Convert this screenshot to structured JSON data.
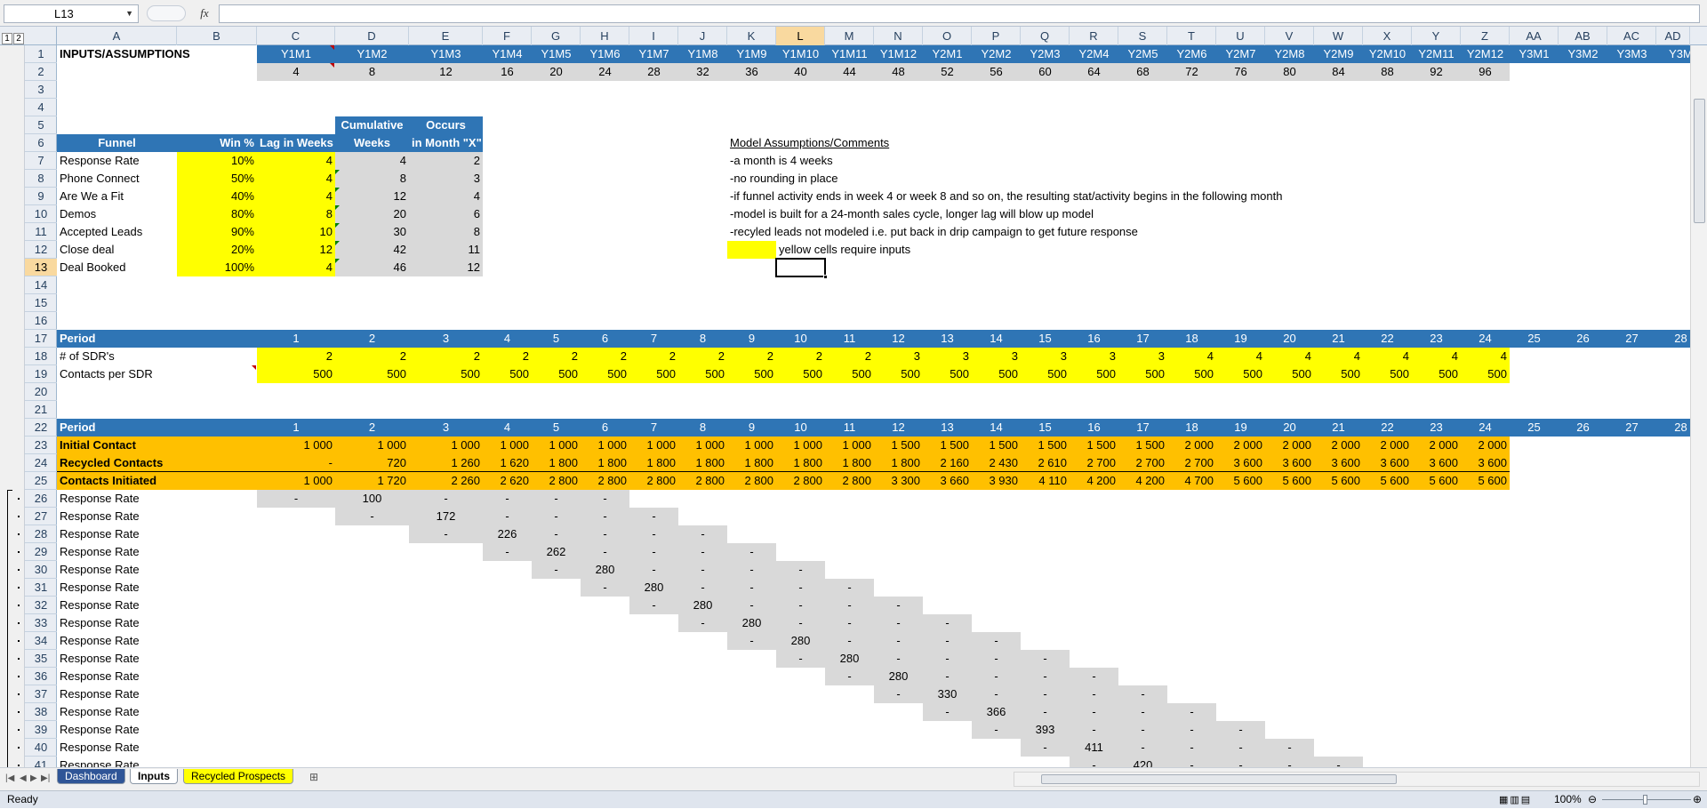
{
  "name_box": "L13",
  "formula_bar": {
    "fx": "fx",
    "value": ""
  },
  "outline_levels": [
    "1",
    "2"
  ],
  "columns": [
    "A",
    "B",
    "C",
    "D",
    "E",
    "F",
    "G",
    "H",
    "I",
    "J",
    "K",
    "L",
    "M",
    "N",
    "O",
    "P",
    "Q",
    "R",
    "S",
    "T",
    "U",
    "V",
    "W",
    "X",
    "Y",
    "Z",
    "AA",
    "AB",
    "AC",
    "AD"
  ],
  "selected_column": "L",
  "rows": [
    "1",
    "2",
    "3",
    "4",
    "5",
    "6",
    "7",
    "8",
    "9",
    "10",
    "11",
    "12",
    "13",
    "14",
    "15",
    "16",
    "17",
    "18",
    "19",
    "20",
    "21",
    "22",
    "23",
    "24",
    "25",
    "26",
    "27",
    "28",
    "29",
    "30",
    "31",
    "32",
    "33",
    "34",
    "35",
    "36",
    "37",
    "38",
    "39",
    "40",
    "41"
  ],
  "selected_row": "13",
  "sheet_title": "INPUTS/ASSUMPTIONS",
  "month_headers": [
    "Y1M1",
    "Y1M2",
    "Y1M3",
    "Y1M4",
    "Y1M5",
    "Y1M6",
    "Y1M7",
    "Y1M8",
    "Y1M9",
    "Y1M10",
    "Y1M11",
    "Y1M12",
    "Y2M1",
    "Y2M2",
    "Y2M3",
    "Y2M4",
    "Y2M5",
    "Y2M6",
    "Y2M7",
    "Y2M8",
    "Y2M9",
    "Y2M10",
    "Y2M11",
    "Y2M12",
    "Y3M1",
    "Y3M2",
    "Y3M3",
    "Y3M"
  ],
  "week_numbers": [
    "4",
    "8",
    "12",
    "16",
    "20",
    "24",
    "28",
    "32",
    "36",
    "40",
    "44",
    "48",
    "52",
    "56",
    "60",
    "64",
    "68",
    "72",
    "76",
    "80",
    "84",
    "88",
    "92",
    "96"
  ],
  "funnel": {
    "headers": [
      "Funnel",
      "Win %",
      "Lag in Weeks",
      "Cumulative",
      "Occurs",
      "Weeks",
      "in Month \"X\""
    ],
    "rows": [
      {
        "name": "Response Rate",
        "win": "10%",
        "lag": "4",
        "cum": "4",
        "month": "2"
      },
      {
        "name": "Phone Connect",
        "win": "50%",
        "lag": "4",
        "cum": "8",
        "month": "3"
      },
      {
        "name": "Are We a Fit",
        "win": "40%",
        "lag": "4",
        "cum": "12",
        "month": "4"
      },
      {
        "name": "Demos",
        "win": "80%",
        "lag": "8",
        "cum": "20",
        "month": "6"
      },
      {
        "name": "Accepted Leads",
        "win": "90%",
        "lag": "10",
        "cum": "30",
        "month": "8"
      },
      {
        "name": "Close deal",
        "win": "20%",
        "lag": "12",
        "cum": "42",
        "month": "11"
      },
      {
        "name": "Deal Booked",
        "win": "100%",
        "lag": "4",
        "cum": "46",
        "month": "12"
      }
    ]
  },
  "comments": {
    "title": "Model Assumptions/Comments",
    "lines": [
      "-a month is 4 weeks",
      "-no rounding in place",
      "-if funnel activity ends in week 4 or week 8 and so on, the resulting stat/activity begins in the following month",
      "-model is built for a 24-month sales cycle, longer lag will blow up model",
      "-recyled leads not modeled i.e. put back in drip campaign to get future response"
    ],
    "legend": "yellow cells require inputs"
  },
  "period_label": "Period",
  "periods": [
    "1",
    "2",
    "3",
    "4",
    "5",
    "6",
    "7",
    "8",
    "9",
    "10",
    "11",
    "12",
    "13",
    "14",
    "15",
    "16",
    "17",
    "18",
    "19",
    "20",
    "21",
    "22",
    "23",
    "24",
    "25",
    "26",
    "27",
    "28"
  ],
  "sdr_label": "# of SDR's",
  "sdr_values": [
    "2",
    "2",
    "2",
    "2",
    "2",
    "2",
    "2",
    "2",
    "2",
    "2",
    "2",
    "3",
    "3",
    "3",
    "3",
    "3",
    "3",
    "4",
    "4",
    "4",
    "4",
    "4",
    "4",
    "4"
  ],
  "contacts_label": "Contacts per SDR",
  "contacts_values": [
    "500",
    "500",
    "500",
    "500",
    "500",
    "500",
    "500",
    "500",
    "500",
    "500",
    "500",
    "500",
    "500",
    "500",
    "500",
    "500",
    "500",
    "500",
    "500",
    "500",
    "500",
    "500",
    "500",
    "500"
  ],
  "initial_label": "Initial Contact",
  "initial_values": [
    "1 000",
    "1 000",
    "1 000",
    "1 000",
    "1 000",
    "1 000",
    "1 000",
    "1 000",
    "1 000",
    "1 000",
    "1 000",
    "1 500",
    "1 500",
    "1 500",
    "1 500",
    "1 500",
    "1 500",
    "2 000",
    "2 000",
    "2 000",
    "2 000",
    "2 000",
    "2 000",
    "2 000"
  ],
  "recycled_label": "Recycled Contacts",
  "recycled_values": [
    "-",
    "720",
    "1 260",
    "1 620",
    "1 800",
    "1 800",
    "1 800",
    "1 800",
    "1 800",
    "1 800",
    "1 800",
    "1 800",
    "2 160",
    "2 430",
    "2 610",
    "2 700",
    "2 700",
    "2 700",
    "3 600",
    "3 600",
    "3 600",
    "3 600",
    "3 600",
    "3 600"
  ],
  "initiated_label": "Contacts Initiated",
  "initiated_values": [
    "1 000",
    "1 720",
    "2 260",
    "2 620",
    "2 800",
    "2 800",
    "2 800",
    "2 800",
    "2 800",
    "2 800",
    "2 800",
    "3 300",
    "3 660",
    "3 930",
    "4 110",
    "4 200",
    "4 200",
    "4 700",
    "5 600",
    "5 600",
    "5 600",
    "5 600",
    "5 600",
    "5 600"
  ],
  "response_label": "Response Rate",
  "response_values": [
    "100",
    "172",
    "226",
    "262",
    "280",
    "280",
    "280",
    "280",
    "280",
    "280",
    "280",
    "330",
    "366",
    "393",
    "411",
    "420"
  ],
  "sheet_tabs": [
    "Dashboard",
    "Inputs",
    "Recycled Prospects"
  ],
  "active_tab": "Inputs",
  "status": {
    "ready": "Ready",
    "zoom": "100%"
  }
}
